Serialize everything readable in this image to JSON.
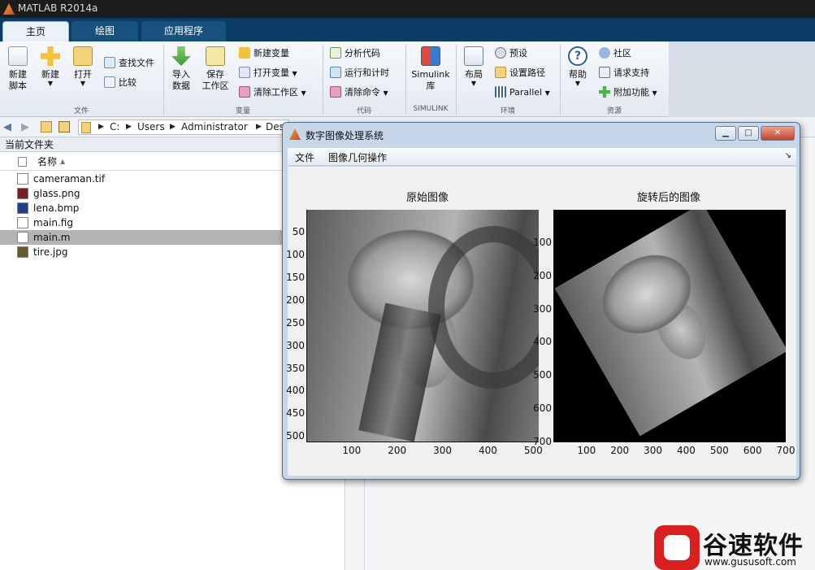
{
  "window": {
    "title": "MATLAB R2014a"
  },
  "tabs": [
    "主页",
    "绘图",
    "应用程序"
  ],
  "ribbon": {
    "groups": {
      "file": "文件",
      "variable": "变量",
      "code": "代码",
      "simulink": "SIMULINK",
      "environment": "环境",
      "resources": "资源"
    },
    "new_script": "新建\n脚本",
    "new": "新建",
    "open": "打开",
    "find_files": "查找文件",
    "compare": "比较",
    "import_data": "导入\n数据",
    "save_workspace": "保存\n工作区",
    "new_variable": "新建变量",
    "open_variable": "打开变量",
    "clear_workspace": "清除工作区",
    "analyze_code": "分析代码",
    "run_and_time": "运行和计时",
    "clear_commands": "清除命令",
    "simulink_library": "Simulink\n库",
    "layout": "布局",
    "preferences": "预设",
    "set_path": "设置路径",
    "parallel": "Parallel",
    "help": "帮助",
    "community": "社区",
    "request_support": "请求支持",
    "add_ons": "附加功能"
  },
  "address": {
    "crumbs": [
      "C:",
      "Users",
      "Administrator",
      "Des"
    ]
  },
  "current_folder": {
    "title": "当前文件夹",
    "column_name": "名称",
    "files": [
      {
        "name": "cameraman.tif",
        "icon": "tif-file-icon",
        "selected": false
      },
      {
        "name": "glass.png",
        "icon": "png-file-icon",
        "selected": false
      },
      {
        "name": "lena.bmp",
        "icon": "bmp-file-icon",
        "selected": false
      },
      {
        "name": "main.fig",
        "icon": "fig-file-icon",
        "selected": false
      },
      {
        "name": "main.m",
        "icon": "m-file-icon",
        "selected": true
      },
      {
        "name": "tire.jpg",
        "icon": "jpg-file-icon",
        "selected": false
      }
    ]
  },
  "figure": {
    "title": "数字图像处理系统",
    "menus": [
      "文件",
      "图像几何操作"
    ],
    "left_axes": {
      "title": "原始图像",
      "yticks": [
        "50",
        "100",
        "150",
        "200",
        "250",
        "300",
        "350",
        "400",
        "450",
        "500"
      ],
      "xticks": [
        "100",
        "200",
        "300",
        "400",
        "500"
      ]
    },
    "right_axes": {
      "title": "旋转后的图像",
      "yticks": [
        "100",
        "200",
        "300",
        "400",
        "500",
        "600",
        "700"
      ],
      "xticks": [
        "100",
        "200",
        "300",
        "400",
        "500",
        "600",
        "700"
      ]
    }
  },
  "watermark": {
    "brand": "谷速软件",
    "url": "www.gususoft.com"
  }
}
